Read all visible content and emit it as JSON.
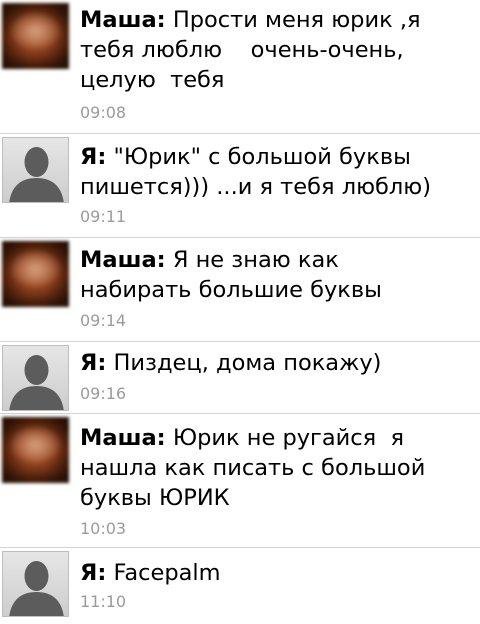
{
  "messages": [
    {
      "sender": "Маша:",
      "text": "Прости меня юрик ,я\nтебя люблю    очень-очень,\nцелую  тебя",
      "time": "09:08",
      "avatar": "contact-photo-icon"
    },
    {
      "sender": "Я:",
      "text": "\"Юрик\" с большой буквы\nпишется))) ...и я тебя люблю)",
      "time": "09:11",
      "avatar": "default-person-icon"
    },
    {
      "sender": "Маша:",
      "text": "Я не знаю как\nнабирать большие буквы",
      "time": "09:14",
      "avatar": "contact-photo-icon"
    },
    {
      "sender": "Я:",
      "text": "Пиздец, дома покажу)",
      "time": "09:16",
      "avatar": "default-person-icon"
    },
    {
      "sender": "Маша:",
      "text": "Юрик не ругайся  я\nнашла как писать с большой\nбуквы ЮРИК",
      "time": "10:03",
      "avatar": "contact-photo-icon"
    },
    {
      "sender": "Я:",
      "text": "Facepalm",
      "time": "11:10",
      "avatar": "default-person-icon"
    }
  ]
}
